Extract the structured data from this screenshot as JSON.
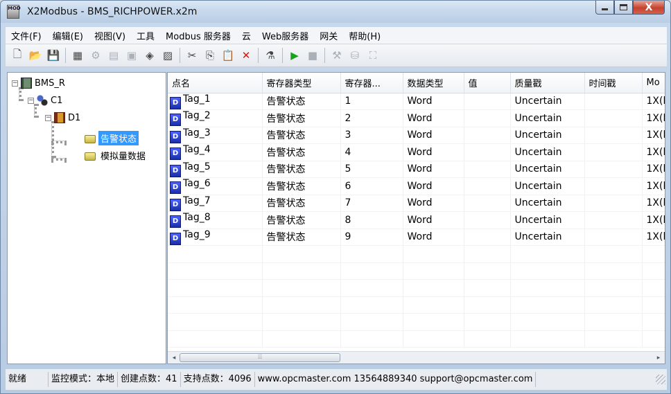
{
  "window": {
    "title": "X2Modbus - BMS_RICHPOWER.x2m",
    "icon_text": "MOD",
    "close_glyph": "X"
  },
  "menu": [
    "文件(F)",
    "编辑(E)",
    "视图(V)",
    "工具",
    "Modbus 服务器",
    "云",
    "Web服务器",
    "网关",
    "帮助(H)"
  ],
  "toolbar": [
    {
      "icon": "new-file-icon",
      "glyph": "🗋",
      "enabled": true
    },
    {
      "icon": "open-folder-icon",
      "glyph": "📂",
      "enabled": true
    },
    {
      "icon": "save-icon",
      "glyph": "💾",
      "enabled": false
    },
    {
      "sep": true
    },
    {
      "icon": "add-server-icon",
      "glyph": "▦",
      "enabled": true
    },
    {
      "icon": "add-channel-icon",
      "glyph": "⚙",
      "enabled": false
    },
    {
      "icon": "add-device-icon",
      "glyph": "▤",
      "enabled": false
    },
    {
      "icon": "add-group-icon",
      "glyph": "▣",
      "enabled": false
    },
    {
      "icon": "add-tag-icon",
      "glyph": "◈",
      "enabled": true
    },
    {
      "icon": "properties-icon",
      "glyph": "▨",
      "enabled": true
    },
    {
      "sep": true
    },
    {
      "icon": "cut-icon",
      "glyph": "✂",
      "enabled": true
    },
    {
      "icon": "copy-icon",
      "glyph": "⎘",
      "enabled": true
    },
    {
      "icon": "paste-icon",
      "glyph": "📋",
      "enabled": false
    },
    {
      "icon": "delete-icon",
      "glyph": "✕",
      "enabled": true,
      "color": "#d01a10"
    },
    {
      "sep": true
    },
    {
      "icon": "monitor-icon",
      "glyph": "⚗",
      "enabled": true
    },
    {
      "sep": true
    },
    {
      "icon": "run-icon",
      "glyph": "▶",
      "enabled": true,
      "color": "#1aa31a"
    },
    {
      "icon": "stop-icon",
      "glyph": "■",
      "enabled": false
    },
    {
      "sep": true
    },
    {
      "icon": "tools-icon",
      "glyph": "⚒",
      "enabled": false
    },
    {
      "icon": "gateway-icon",
      "glyph": "⛁",
      "enabled": false
    },
    {
      "icon": "export-icon",
      "glyph": "⛶",
      "enabled": false
    }
  ],
  "tree": {
    "root": "BMS_R",
    "channel": "C1",
    "device": "D1",
    "groups": [
      "告警状态",
      "模拟量数据"
    ],
    "selected": "告警状态"
  },
  "columns": [
    "点名",
    "寄存器类型",
    "寄存器...",
    "数据类型",
    "值",
    "质量戳",
    "时间戳",
    "Mo"
  ],
  "tag_icon_text": "D",
  "rows": [
    {
      "name": "Tag_1",
      "reg_type": "告警状态",
      "reg": "1",
      "dtype": "Word",
      "value": "",
      "quality": "Uncertain",
      "time": "",
      "mo": "1X(l"
    },
    {
      "name": "Tag_2",
      "reg_type": "告警状态",
      "reg": "2",
      "dtype": "Word",
      "value": "",
      "quality": "Uncertain",
      "time": "",
      "mo": "1X(l"
    },
    {
      "name": "Tag_3",
      "reg_type": "告警状态",
      "reg": "3",
      "dtype": "Word",
      "value": "",
      "quality": "Uncertain",
      "time": "",
      "mo": "1X(l"
    },
    {
      "name": "Tag_4",
      "reg_type": "告警状态",
      "reg": "4",
      "dtype": "Word",
      "value": "",
      "quality": "Uncertain",
      "time": "",
      "mo": "1X(l"
    },
    {
      "name": "Tag_5",
      "reg_type": "告警状态",
      "reg": "5",
      "dtype": "Word",
      "value": "",
      "quality": "Uncertain",
      "time": "",
      "mo": "1X(l"
    },
    {
      "name": "Tag_6",
      "reg_type": "告警状态",
      "reg": "6",
      "dtype": "Word",
      "value": "",
      "quality": "Uncertain",
      "time": "",
      "mo": "1X(l"
    },
    {
      "name": "Tag_7",
      "reg_type": "告警状态",
      "reg": "7",
      "dtype": "Word",
      "value": "",
      "quality": "Uncertain",
      "time": "",
      "mo": "1X(l"
    },
    {
      "name": "Tag_8",
      "reg_type": "告警状态",
      "reg": "8",
      "dtype": "Word",
      "value": "",
      "quality": "Uncertain",
      "time": "",
      "mo": "1X(l"
    },
    {
      "name": "Tag_9",
      "reg_type": "告警状态",
      "reg": "9",
      "dtype": "Word",
      "value": "",
      "quality": "Uncertain",
      "time": "",
      "mo": "1X(l"
    }
  ],
  "scrollbar": {
    "left_arrow": "◂",
    "right_arrow": "▸",
    "thumb_grip": "⦙⦙⦙"
  },
  "status": [
    "就绪",
    "监控模式：本地",
    "创建点数：41",
    "支持点数：4096",
    "www.opcmaster.com 13564889340 support@opcmaster.com"
  ]
}
